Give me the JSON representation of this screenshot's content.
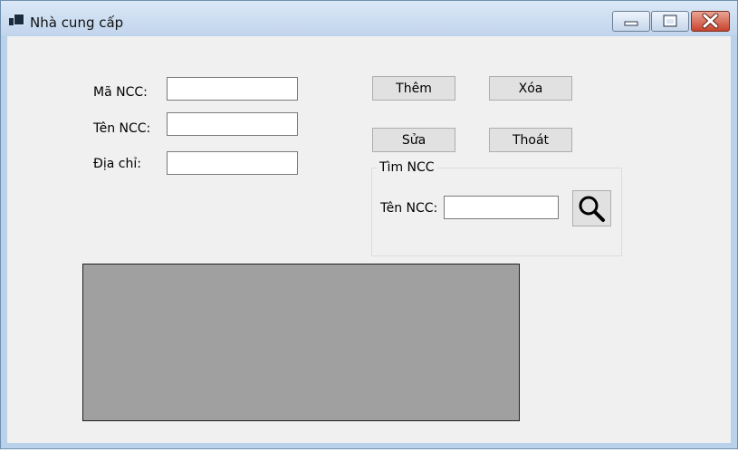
{
  "window": {
    "title": "Nhà cung cấp",
    "icons": [
      "app-icon",
      "minimize-icon",
      "maximize-icon",
      "close-icon"
    ]
  },
  "form": {
    "ma_ncc_label": "Mã NCC:",
    "ma_ncc_value": "",
    "ten_ncc_label": "Tên NCC:",
    "ten_ncc_value": "",
    "dia_chi_label": "Địa chỉ:",
    "dia_chi_value": ""
  },
  "buttons": {
    "them": "Thêm",
    "xoa": "Xóa",
    "sua": "Sửa",
    "thoat": "Thoát"
  },
  "search": {
    "group_title": "Tìm NCC",
    "label": "Tên NCC:",
    "value": "",
    "button_icon": "search-icon"
  },
  "grid": {
    "rows": []
  },
  "colors": {
    "client_background": "#f0f0f0",
    "button_background": "#e1e1e1",
    "grid_background": "#a0a0a0",
    "close_button": "#c8432c"
  }
}
